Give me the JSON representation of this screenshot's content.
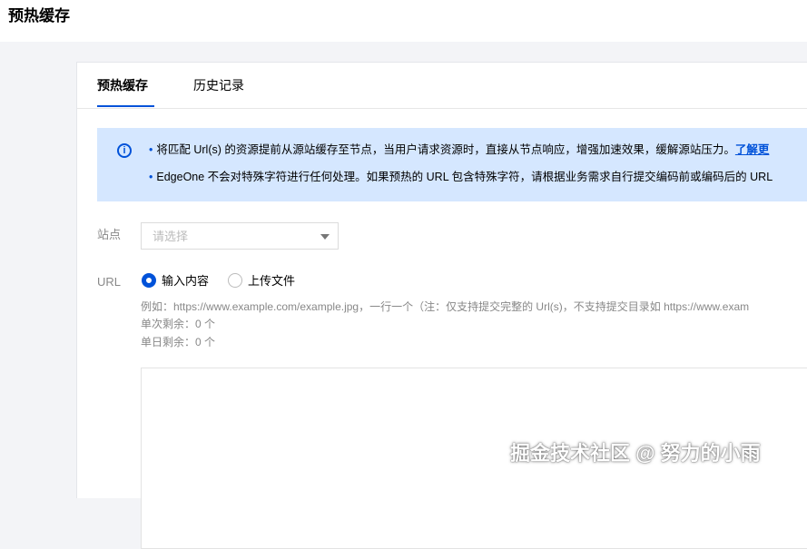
{
  "header": {
    "title": "预热缓存"
  },
  "tabs": [
    {
      "label": "预热缓存",
      "active": true
    },
    {
      "label": "历史记录",
      "active": false
    }
  ],
  "notice": {
    "icon": "info-icon",
    "line1_text": "将匹配 Url(s) 的资源提前从源站缓存至节点，当用户请求资源时，直接从节点响应，增强加速效果，缓解源站压力。",
    "line1_link": "了解更",
    "line2_text": "EdgeOne 不会对特殊字符进行任何处理。如果预热的 URL 包含特殊字符，请根据业务需求自行提交编码前或编码后的 URL",
    "bullet": "•"
  },
  "form": {
    "site_label": "站点",
    "site_placeholder": "请选择",
    "url_label": "URL",
    "radio_input": "输入内容",
    "radio_upload": "上传文件",
    "selected_mode": "输入内容",
    "hint_example": "例如：https://www.example.com/example.jpg，一行一个（注：仅支持提交完整的 Url(s)，不支持提交目录如 https://www.exam",
    "hint_single": "单次剩余：0 个",
    "hint_daily": "单日剩余：0 个"
  },
  "watermark": "掘金技术社区 @ 努力的小雨",
  "colors": {
    "accent": "#0052d9",
    "notice_bg": "#d5e7ff",
    "page_bg": "#f3f4f7"
  }
}
